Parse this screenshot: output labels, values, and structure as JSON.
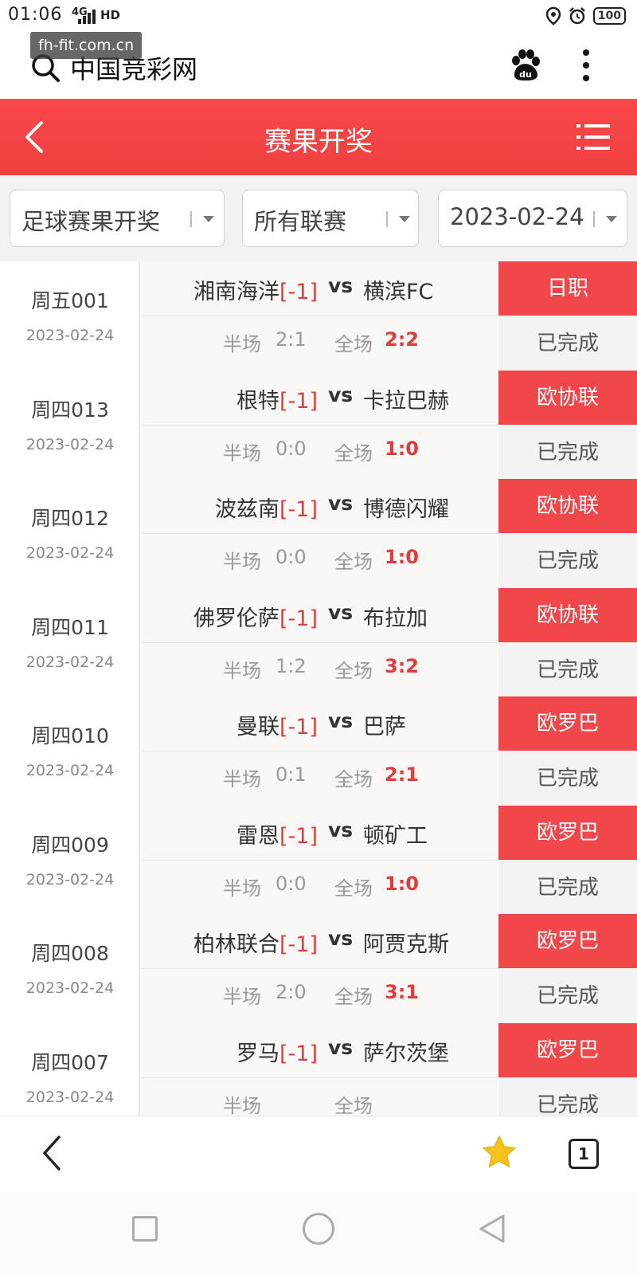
{
  "status_bar": {
    "time": "01:06",
    "network": "4G",
    "hd": "HD",
    "battery": "100"
  },
  "browser": {
    "watermark": "fh-fit.com.cn",
    "site_title": "中国竞彩网"
  },
  "header": {
    "title": "赛果开奖"
  },
  "filters": [
    {
      "label": "足球赛果开奖"
    },
    {
      "label": "所有联赛"
    },
    {
      "label": "2023-02-24"
    }
  ],
  "labels": {
    "half": "半场",
    "full": "全场",
    "vs": "vs"
  },
  "matches": [
    {
      "code": "周五001",
      "date": "2023-02-24",
      "home": "湘南海洋",
      "handicap": "[-1]",
      "away": "横滨FC",
      "half_score": "2:1",
      "full_score": "2:2",
      "league": "日职",
      "status": "已完成"
    },
    {
      "code": "周四013",
      "date": "2023-02-24",
      "home": "根特",
      "handicap": "[-1]",
      "away": "卡拉巴赫",
      "half_score": "0:0",
      "full_score": "1:0",
      "league": "欧协联",
      "status": "已完成"
    },
    {
      "code": "周四012",
      "date": "2023-02-24",
      "home": "波兹南",
      "handicap": "[-1]",
      "away": "博德闪耀",
      "half_score": "0:0",
      "full_score": "1:0",
      "league": "欧协联",
      "status": "已完成"
    },
    {
      "code": "周四011",
      "date": "2023-02-24",
      "home": "佛罗伦萨",
      "handicap": "[-1]",
      "away": "布拉加",
      "half_score": "1:2",
      "full_score": "3:2",
      "league": "欧协联",
      "status": "已完成"
    },
    {
      "code": "周四010",
      "date": "2023-02-24",
      "home": "曼联",
      "handicap": "[-1]",
      "away": "巴萨",
      "half_score": "0:1",
      "full_score": "2:1",
      "league": "欧罗巴",
      "status": "已完成"
    },
    {
      "code": "周四009",
      "date": "2023-02-24",
      "home": "雷恩",
      "handicap": "[-1]",
      "away": "顿矿工",
      "half_score": "0:0",
      "full_score": "1:0",
      "league": "欧罗巴",
      "status": "已完成"
    },
    {
      "code": "周四008",
      "date": "2023-02-24",
      "home": "柏林联合",
      "handicap": "[-1]",
      "away": "阿贾克斯",
      "half_score": "2:0",
      "full_score": "3:1",
      "league": "欧罗巴",
      "status": "已完成"
    },
    {
      "code": "周四007",
      "date": "2023-02-24",
      "home": "罗马",
      "handicap": "[-1]",
      "away": "萨尔茨堡",
      "half_score": "",
      "full_score": "",
      "league": "欧罗巴",
      "status": "已完成"
    }
  ],
  "browser_nav": {
    "tab_count": "1"
  },
  "colors": {
    "accent": "#f1474a",
    "score_red": "#e23b3b"
  },
  "icons": [
    "search-icon",
    "baidu-paw-icon",
    "more-icon",
    "back-icon",
    "menu-icon",
    "dropdown-arrow-icon",
    "star-icon",
    "tabs-icon"
  ]
}
